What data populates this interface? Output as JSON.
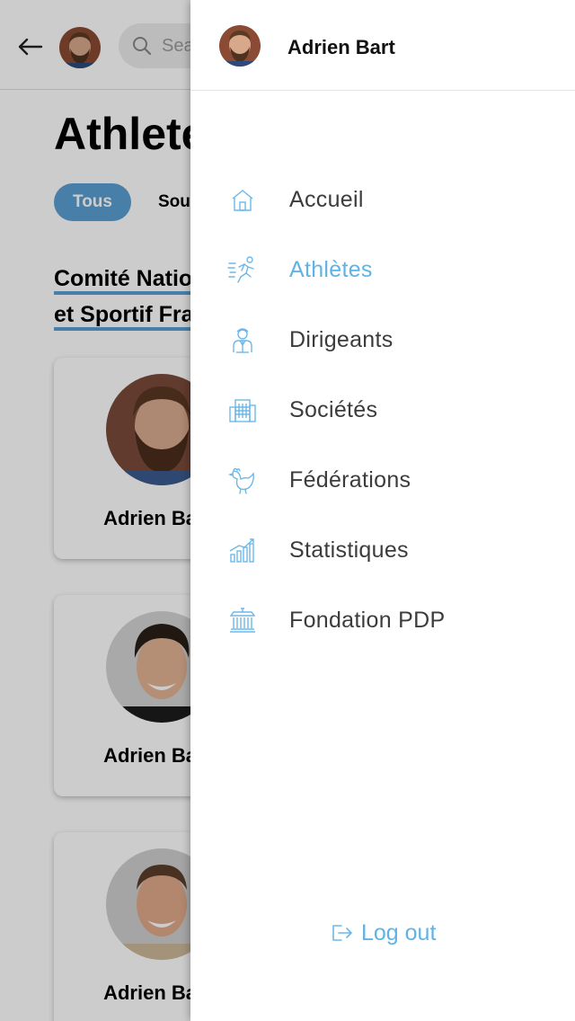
{
  "page": {
    "search_placeholder": "Search",
    "title": "Athletes",
    "filter_all": "Tous",
    "filter_other": "Sous",
    "section_title_line1": "Comité National Olympique",
    "section_title_line2": "et Sportif Français",
    "cards": [
      {
        "name": "Adrien Bart"
      },
      {
        "name": "Adrien Bart"
      },
      {
        "name": "Adrien Bart"
      }
    ]
  },
  "drawer": {
    "user_name": "Adrien Bart",
    "items": [
      {
        "label": "Accueil",
        "icon": "home-icon"
      },
      {
        "label": "Athlètes",
        "icon": "runner-icon",
        "active": true
      },
      {
        "label": "Dirigeants",
        "icon": "leader-icon"
      },
      {
        "label": "Sociétés",
        "icon": "building-icon"
      },
      {
        "label": "Fédérations",
        "icon": "rooster-icon"
      },
      {
        "label": "Statistiques",
        "icon": "chart-icon"
      },
      {
        "label": "Fondation PDP",
        "icon": "institution-icon"
      }
    ],
    "logout_label": "Log out"
  },
  "colors": {
    "accent": "#5fb3e6",
    "chip": "#5b9fd4",
    "text": "#3c3c3c"
  }
}
